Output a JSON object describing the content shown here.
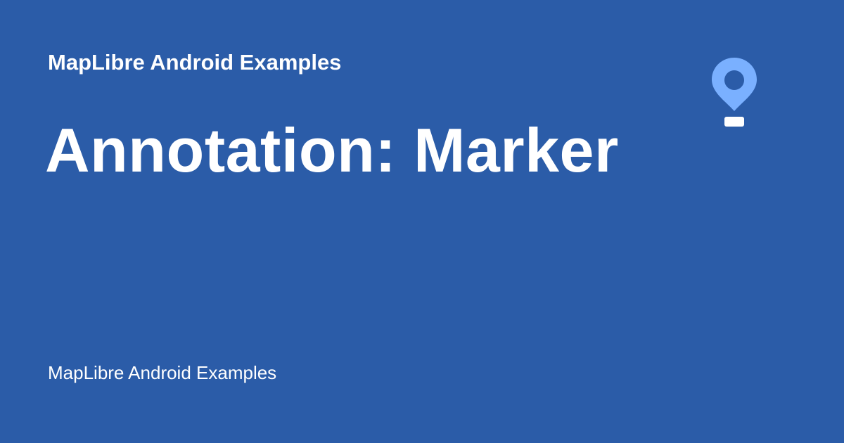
{
  "header": {
    "site_title": "MapLibre Android Examples"
  },
  "main": {
    "page_title": "Annotation: Marker"
  },
  "footer": {
    "text": "MapLibre Android Examples"
  },
  "logo": {
    "icon": "map-marker-icon",
    "pin_color": "#7ab0ff",
    "base_color": "#ffffff"
  },
  "colors": {
    "background": "#2b5ca8",
    "text": "#ffffff"
  }
}
